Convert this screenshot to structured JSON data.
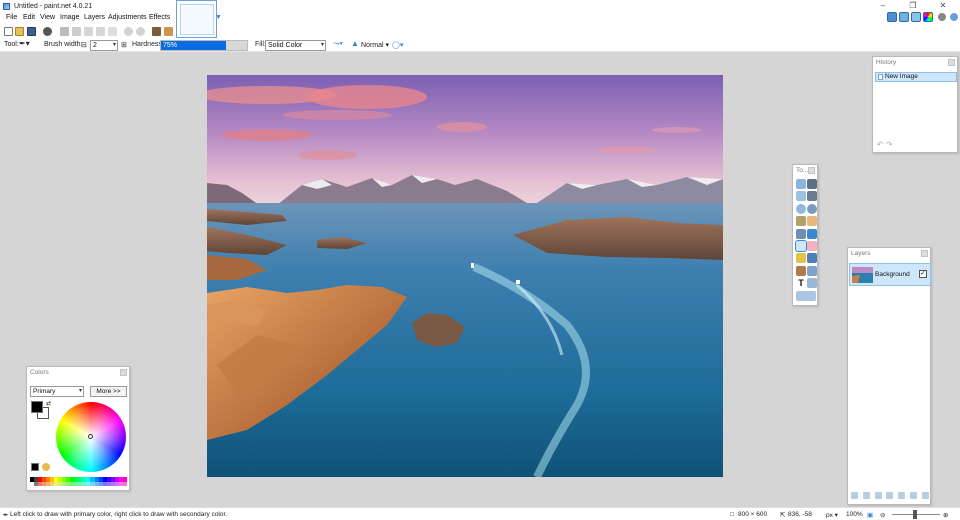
{
  "window": {
    "title": "Untitled - paint.net 4.0.21"
  },
  "menu": [
    "File",
    "Edit",
    "View",
    "Image",
    "Layers",
    "Adjustments",
    "Effects"
  ],
  "options": {
    "tool_label": "Tool:",
    "brush_width_label": "Brush width:",
    "brush_width": "2",
    "hardness_label": "Hardness:",
    "hardness": "75%",
    "hardness_fraction": 0.75,
    "fill_label": "Fill:",
    "fill": "Solid Color",
    "blend": "Normal"
  },
  "history": {
    "title": "History",
    "items": [
      "New Image"
    ]
  },
  "tools": {
    "title": "To..."
  },
  "layers": {
    "title": "Layers",
    "items": [
      {
        "name": "Background",
        "visible": true
      }
    ]
  },
  "colors": {
    "title": "Colors",
    "selector": "Primary",
    "more_button": "More >>",
    "primary": "#000000",
    "secondary": "#ffffff"
  },
  "status": {
    "hint": "Left click to draw with primary color, right click to draw with secondary color.",
    "image_size": "800 × 600",
    "cursor": "836, -58",
    "unit": "px",
    "zoom": "100%"
  },
  "accent": "#0a6ce0"
}
